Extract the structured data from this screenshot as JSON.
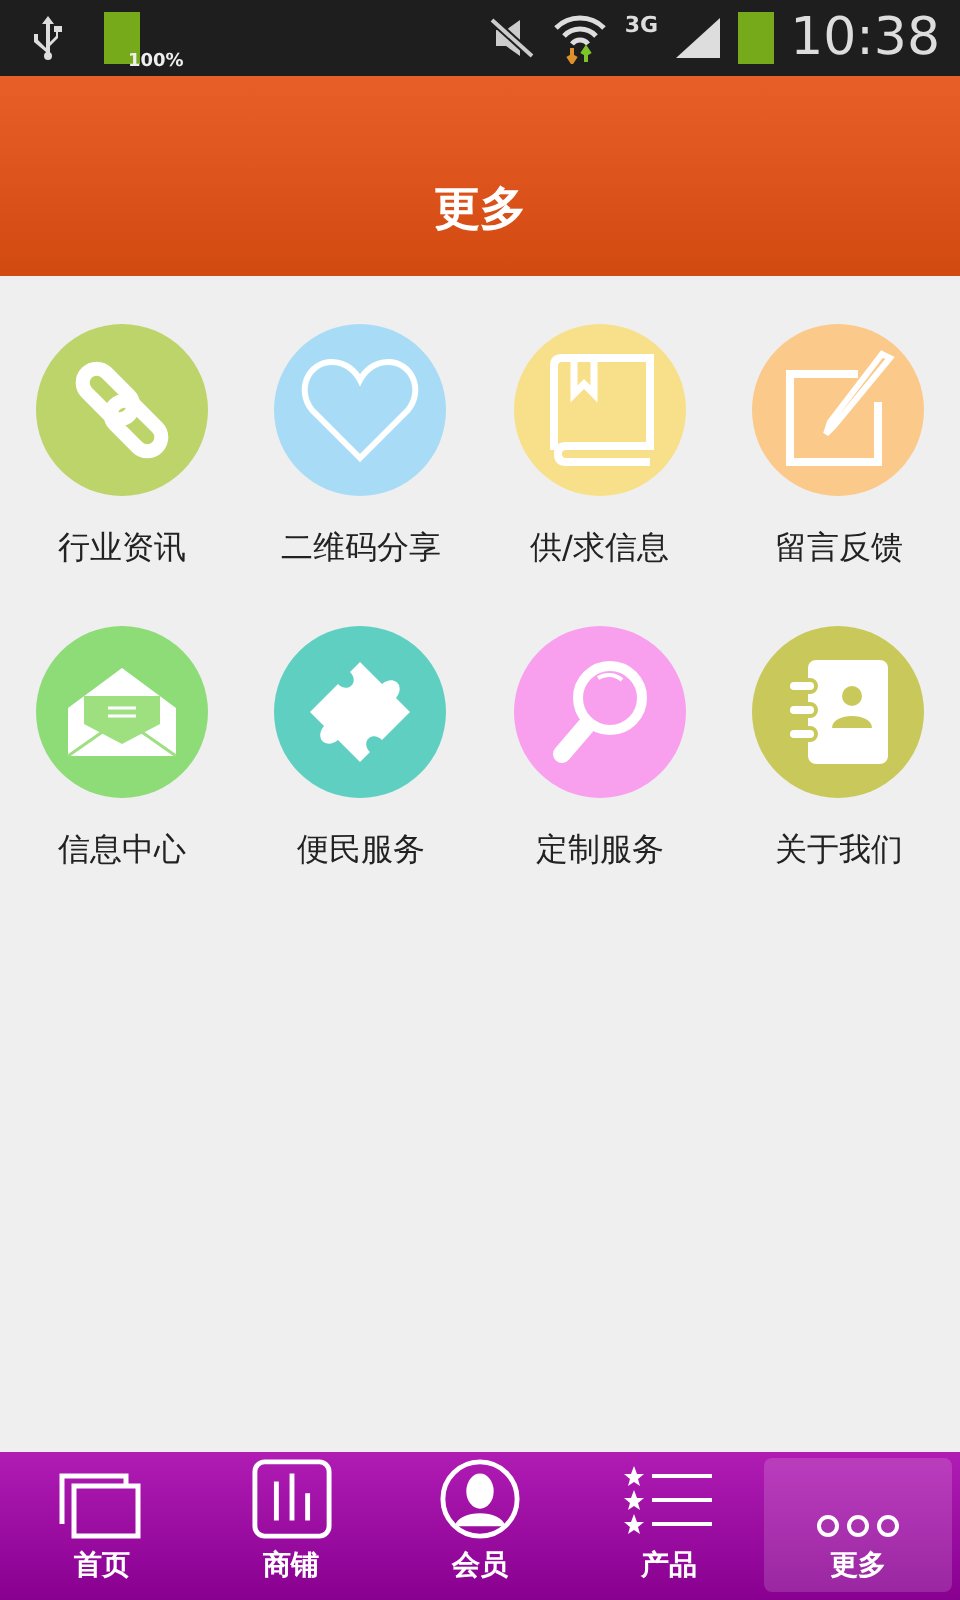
{
  "status_bar": {
    "battery_text": "100%",
    "network": "3G",
    "time": "10:38"
  },
  "header": {
    "title": "更多"
  },
  "grid": [
    {
      "label": "行业资讯",
      "kind": "link",
      "color": "#bcd46a"
    },
    {
      "label": "二维码分享",
      "kind": "heart",
      "color": "#a8dcf6"
    },
    {
      "label": "供/求信息",
      "kind": "book",
      "color": "#f8e08a"
    },
    {
      "label": "留言反馈",
      "kind": "edit",
      "color": "#fbc98a"
    },
    {
      "label": "信息中心",
      "kind": "mail",
      "color": "#8edc78"
    },
    {
      "label": "便民服务",
      "kind": "puzzle",
      "color": "#5ecfc0"
    },
    {
      "label": "定制服务",
      "kind": "search",
      "color": "#f8a0ee"
    },
    {
      "label": "关于我们",
      "kind": "contacts",
      "color": "#c8c95a"
    }
  ],
  "tabs": [
    {
      "label": "首页",
      "kind": "home",
      "selected": false
    },
    {
      "label": "商铺",
      "kind": "shop",
      "selected": false
    },
    {
      "label": "会员",
      "kind": "member",
      "selected": false
    },
    {
      "label": "产品",
      "kind": "products",
      "selected": false
    },
    {
      "label": "更多",
      "kind": "more",
      "selected": true
    }
  ]
}
